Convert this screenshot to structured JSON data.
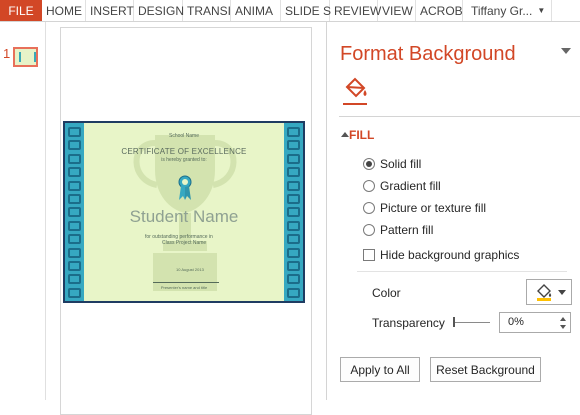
{
  "ribbon": {
    "file_label": "FILE",
    "tabs": [
      "HOME",
      "INSERT",
      "DESIGN",
      "TRANSI",
      "ANIMA",
      "SLIDE S",
      "REVIEW",
      "VIEW",
      "ACROB"
    ],
    "user": "Tiffany Gr..."
  },
  "thumbnails": {
    "slide_number": "1"
  },
  "slide": {
    "school": "School Name",
    "title": "CERTIFICATE OF EXCELLENCE",
    "granted": "is hereby granted to:",
    "student_name": "Student Name",
    "outstanding": "for outstanding performance in",
    "project": "Class Project Name",
    "date": "10 August 2013",
    "signature": "Presenter's name and title",
    "colors": {
      "background": "#e8f5c8",
      "border": "#36a8c1",
      "frame": "#1f3c62"
    }
  },
  "pane": {
    "title": "Format Background",
    "section": "FILL",
    "fill_options": [
      {
        "label": "Solid fill",
        "selected": true
      },
      {
        "label": "Gradient fill",
        "selected": false
      },
      {
        "label": "Picture or texture fill",
        "selected": false
      },
      {
        "label": "Pattern fill",
        "selected": false
      }
    ],
    "hide_graphics_label": "Hide background graphics",
    "hide_graphics_checked": false,
    "color_label": "Color",
    "transparency_label": "Transparency",
    "transparency_value": "0%",
    "apply_all_label": "Apply to All",
    "reset_label": "Reset Background",
    "accent": "#d24726",
    "icons": [
      "paint-bucket-icon",
      "pane-menu-chevron-icon",
      "collapse-arrow-icon",
      "color-picker-icon"
    ]
  }
}
